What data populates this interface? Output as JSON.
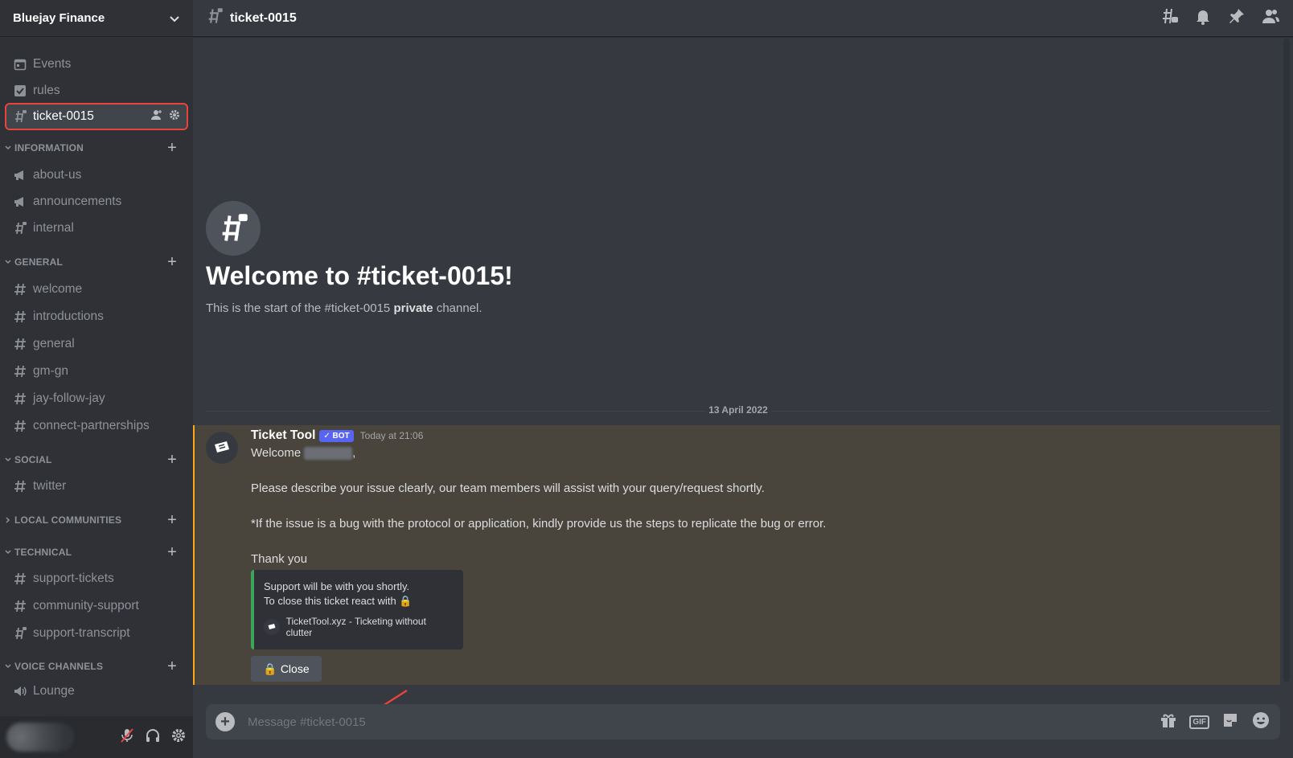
{
  "server": {
    "name": "Bluejay Finance"
  },
  "channels_top": [
    {
      "label": "Events",
      "icon": "calendar-icon"
    },
    {
      "label": "rules",
      "icon": "checkbox-icon"
    },
    {
      "label": "ticket-0015",
      "icon": "locked-hash-icon",
      "active": true
    }
  ],
  "categories": [
    {
      "name": "INFORMATION",
      "channels": [
        "about-us",
        "announcements",
        "internal"
      ]
    },
    {
      "name": "GENERAL",
      "channels": [
        "welcome",
        "introductions",
        "general",
        "gm-gn",
        "jay-follow-jay",
        "connect-partnerships"
      ]
    },
    {
      "name": "SOCIAL",
      "channels": [
        "twitter"
      ]
    },
    {
      "name": "LOCAL COMMUNITIES",
      "channels": []
    },
    {
      "name": "TECHNICAL",
      "channels": [
        "support-tickets",
        "community-support",
        "support-transcript"
      ]
    },
    {
      "name": "VOICE CHANNELS",
      "channels": [
        "Lounge"
      ]
    }
  ],
  "header": {
    "channel": "ticket-0015"
  },
  "welcome": {
    "title": "Welcome to #ticket-0015!",
    "sub_prefix": "This is the start of the #ticket-0015 ",
    "sub_bold": "private",
    "sub_suffix": " channel."
  },
  "date_divider": "13 April 2022",
  "message": {
    "author": "Ticket Tool",
    "bot_tag": "✓ BOT",
    "timestamp": "Today at 21:06",
    "line1": "Welcome",
    "line1_suffix": ",",
    "line2": "Please describe your issue clearly, our team members will assist with your query/request shortly.",
    "line3": "*If the issue is a bug with the protocol or application, kindly provide us the steps to replicate the bug or error.",
    "line4": "Thank you",
    "embed_line1": "Support will be with you shortly.",
    "embed_line2": "To close this ticket react with",
    "embed_footer": "TicketTool.xyz - Ticketing without clutter",
    "button": "Close"
  },
  "composer": {
    "placeholder": "Message #ticket-0015"
  },
  "colors": {
    "accent": "#5865f2",
    "highlight": "#e8443e",
    "mention_bar": "#faa81a",
    "embed_bar": "#3ba55d"
  }
}
